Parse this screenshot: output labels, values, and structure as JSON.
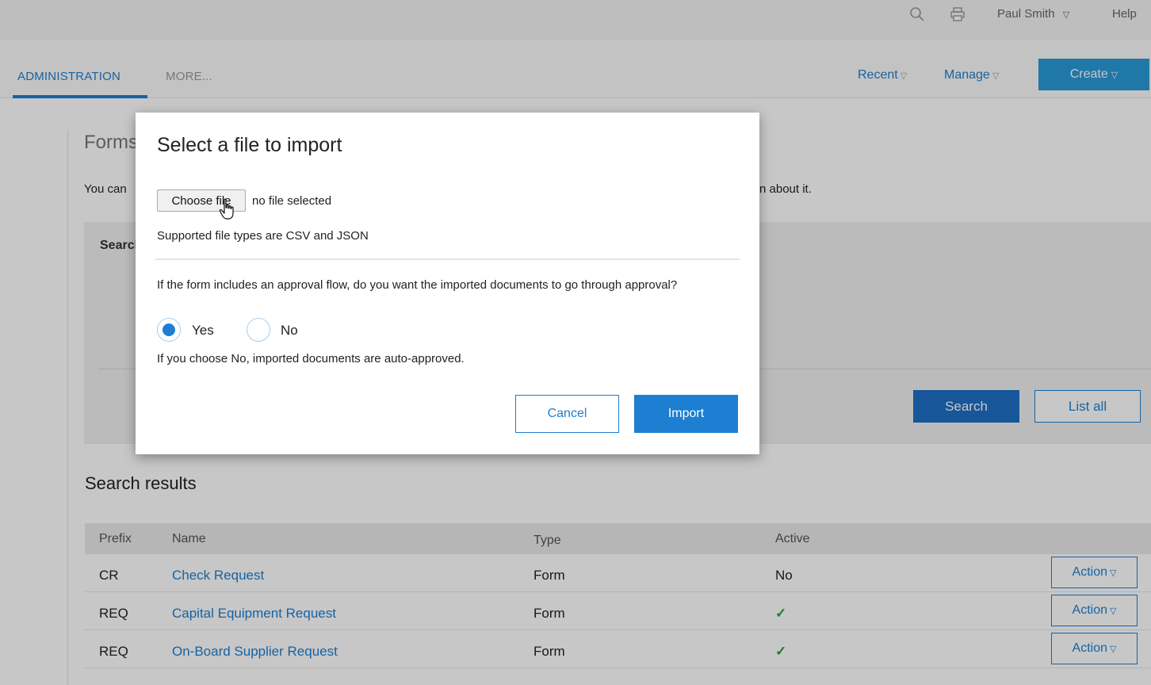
{
  "topbar": {
    "search_icon": "search-icon",
    "print_icon": "print-icon",
    "user_name": "Paul Smith",
    "user_caret": "▽",
    "help": "Help"
  },
  "nav": {
    "tab_admin": "ADMINISTRATION",
    "tab_more": "MORE...",
    "recent": "Recent",
    "manage": "Manage",
    "create": "Create",
    "caret": "▽"
  },
  "page": {
    "title": "Forms",
    "description_visible": "You can",
    "description_tail": "n about it.",
    "search_label": "Search",
    "search_button": "Search",
    "list_all_button": "List all"
  },
  "results": {
    "title": "Search results",
    "columns": [
      "Prefix",
      "Name",
      "Type",
      "Active"
    ],
    "rows": [
      {
        "prefix": "CR",
        "name": "Check Request",
        "type": "Form",
        "active": "No",
        "action": "Action"
      },
      {
        "prefix": "REQ",
        "name": "Capital Equipment Request",
        "type": "Form",
        "active": "✓",
        "action": "Action"
      },
      {
        "prefix": "REQ",
        "name": "On-Board Supplier Request",
        "type": "Form",
        "active": "✓",
        "action": "Action"
      }
    ]
  },
  "modal": {
    "title": "Select a file to import",
    "choose_file": "Choose file",
    "no_file": "no file selected",
    "supported_types": "Supported file types are CSV and JSON",
    "question": "If the form includes an approval flow, do you want the imported documents to go through approval?",
    "option_yes": "Yes",
    "option_no": "No",
    "selected_option": "Yes",
    "hint": "If you choose No, imported documents are auto-approved.",
    "cancel": "Cancel",
    "import": "Import"
  },
  "colors": {
    "accent": "#1d7fd1",
    "create_button": "#2a9ad8",
    "search_button": "#1d6fc4",
    "check": "#2f9a3b"
  }
}
